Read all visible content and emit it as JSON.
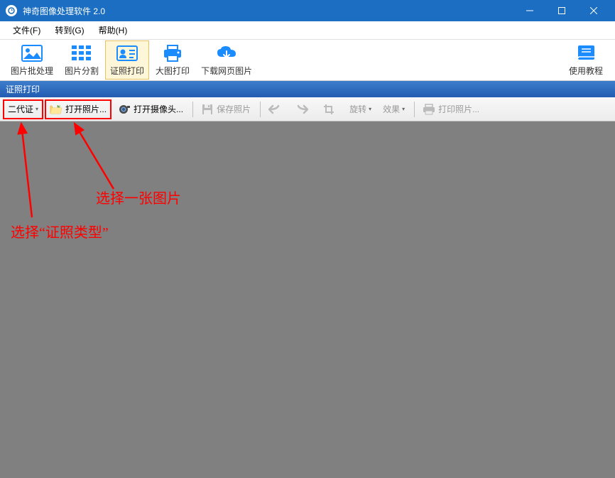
{
  "window": {
    "title": "神奇图像处理软件 2.0"
  },
  "menu": {
    "file": "文件(F)",
    "goto": "转到(G)",
    "help": "帮助(H)"
  },
  "ribbon": {
    "batch": "图片批处理",
    "split": "图片分割",
    "idprint": "证照打印",
    "bigprint": "大图打印",
    "download": "下载网页图片",
    "tutorial": "使用教程"
  },
  "section": {
    "title": "证照打印"
  },
  "toolbar": {
    "idtype": "二代证",
    "openphoto": "打开照片...",
    "opencamera": "打开摄像头...",
    "savephoto": "保存照片",
    "rotate": "旋转",
    "effect": "效果",
    "printphoto": "打印照片..."
  },
  "annotations": {
    "selectType": "选择“证照类型”",
    "selectImage": "选择一张图片"
  }
}
